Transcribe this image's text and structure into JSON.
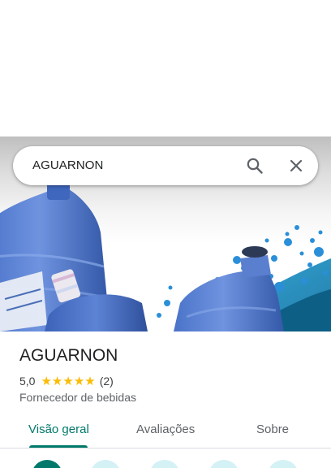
{
  "search": {
    "query": "AGUARNON"
  },
  "place": {
    "name": "AGUARNON",
    "rating": "5,0",
    "stars": 5,
    "review_count": "(2)",
    "category": "Fornecedor de bebidas"
  },
  "tabs": [
    {
      "label": "Visão geral",
      "active": true
    },
    {
      "label": "Avaliações",
      "active": false
    },
    {
      "label": "Sobre",
      "active": false
    }
  ],
  "icons": {
    "search": "search-icon",
    "close": "close-icon",
    "star": "star-icon"
  },
  "colors": {
    "accent": "#00796b",
    "star": "#fbbc04",
    "action_bg": "#d4f1f6"
  }
}
